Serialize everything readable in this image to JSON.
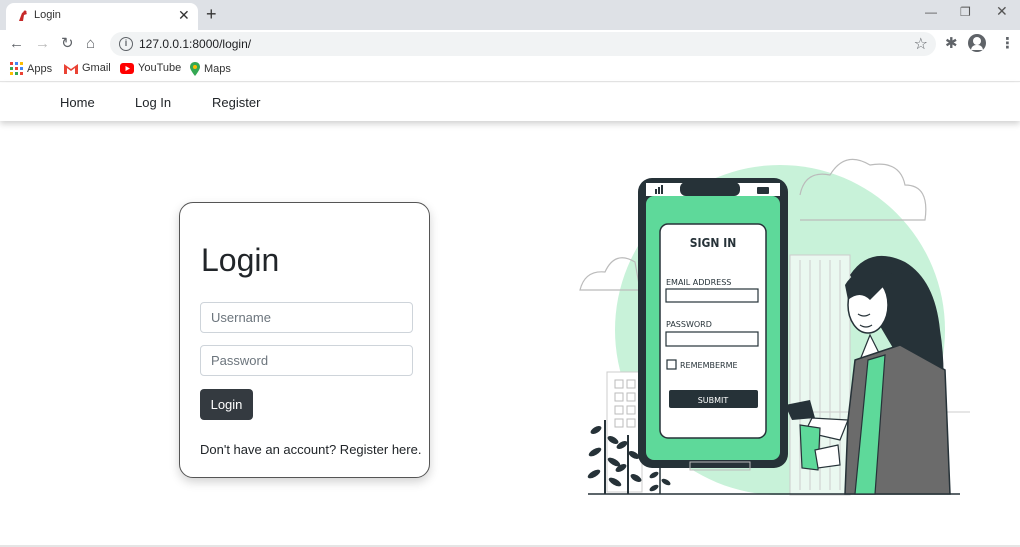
{
  "browser": {
    "tab_title": "Login",
    "url": "127.0.0.1:8000/login/",
    "bookmarks": [
      {
        "label": "Apps",
        "icon": "apps-grid-icon"
      },
      {
        "label": "Gmail",
        "icon": "gmail-icon"
      },
      {
        "label": "YouTube",
        "icon": "youtube-icon"
      },
      {
        "label": "Maps",
        "icon": "maps-pin-icon"
      }
    ]
  },
  "navbar": {
    "links": [
      "Home",
      "Log In",
      "Register"
    ]
  },
  "login_card": {
    "title": "Login",
    "username_placeholder": "Username",
    "password_placeholder": "Password",
    "submit_label": "Login",
    "register_prompt": "Don't have an account? Register here."
  },
  "illustration": {
    "heading": "SIGN IN",
    "email_label": "EMAIL ADDRESS",
    "password_label": "PASSWORD",
    "remember_label": "REMEMBERME",
    "submit_label": "SUBMIT"
  },
  "colors": {
    "accent_green": "#5ed99a",
    "light_green": "#c8f2d9",
    "dark": "#263238",
    "button_dark": "#343a40"
  }
}
